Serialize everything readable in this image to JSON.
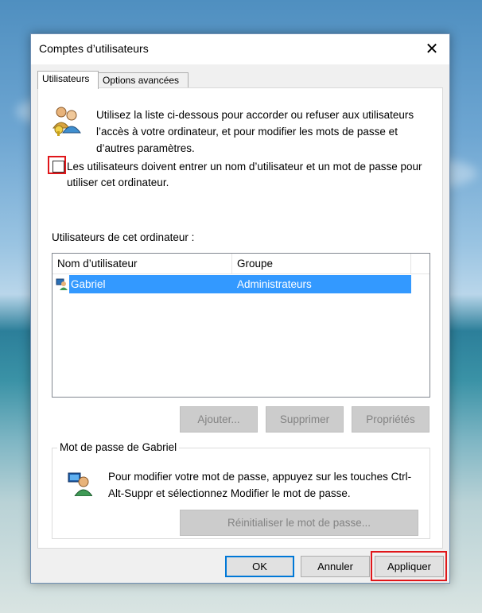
{
  "dialog": {
    "title": "Comptes d’utilisateurs",
    "close_glyph": "✕"
  },
  "tabs": [
    {
      "label": "Utilisateurs",
      "active": true
    },
    {
      "label": "Options avancées",
      "active": false
    }
  ],
  "intro_text": "Utilisez la liste ci-dessous pour accorder ou refuser aux utilisateurs l’accès à votre ordinateur, et pour modifier les mots de passe et d’autres paramètres.",
  "require_login": {
    "label": "Les utilisateurs doivent entrer un nom d’utilisateur et un mot de passe pour utiliser cet ordinateur.",
    "checked": false
  },
  "users_list": {
    "label": "Utilisateurs de cet ordinateur :",
    "columns": [
      "Nom d’utilisateur",
      "Groupe"
    ],
    "rows": [
      {
        "name": "Gabriel",
        "group": "Administrateurs",
        "selected": true
      }
    ]
  },
  "list_buttons": {
    "add": "Ajouter...",
    "remove": "Supprimer",
    "properties": "Propriétés"
  },
  "password_group": {
    "title": "Mot de passe de Gabriel",
    "text": "Pour modifier votre mot de passe, appuyez sur les touches Ctrl-Alt-Suppr et sélectionnez Modifier le mot de passe.",
    "reset_button": "Réinitialiser le mot de passe..."
  },
  "footer": {
    "ok": "OK",
    "cancel": "Annuler",
    "apply": "Appliquer"
  },
  "colors": {
    "selection": "#3399ff",
    "highlight_box": "#e0161a",
    "default_button_border": "#0078d7"
  }
}
